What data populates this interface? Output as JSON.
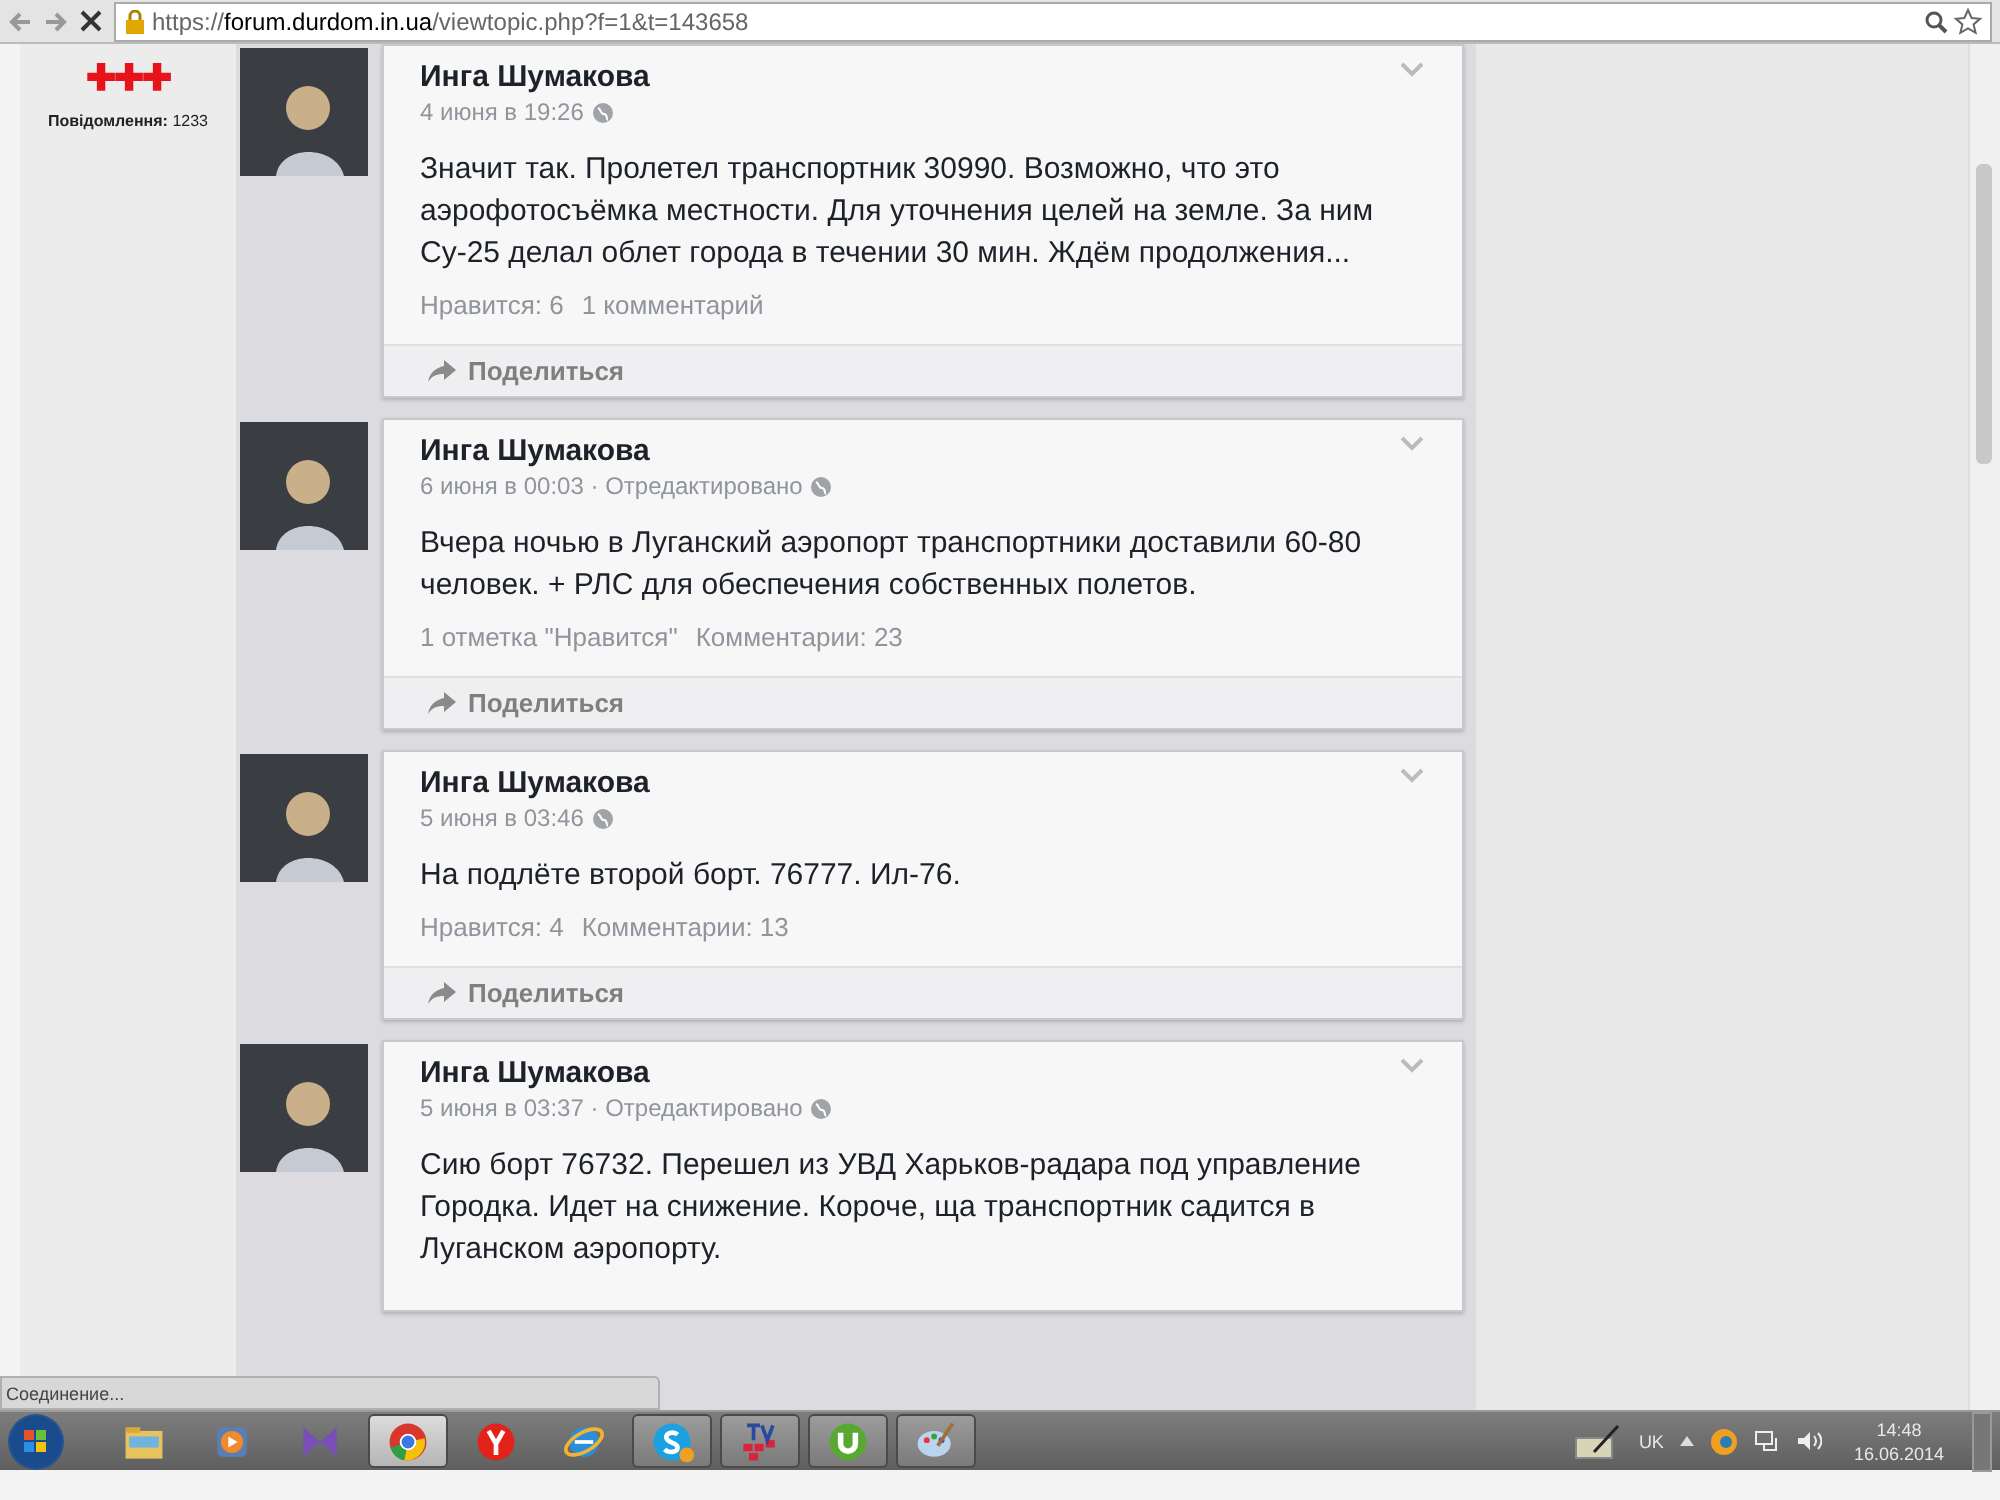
{
  "browser": {
    "url_scheme": "https://",
    "url_host": "forum.durdom.in.ua",
    "url_path": "/viewtopic.php?f=1&t=143658"
  },
  "user_panel": {
    "rank_icons": "✚✚✚",
    "posts_label": "Повідомлення:",
    "posts_count": "1233"
  },
  "posts": [
    {
      "author": "Инга Шумакова",
      "time": "4 июня в 19:26",
      "text": "Значит так. Пролетел транспортник 30990. Возможно, что это аэрофотосъёмка местности. Для уточнения целей на земле. За ним Су-25 делал облет города в течении 30 мин. Ждём продолжения...",
      "likes": "Нравится: 6",
      "comments": "1 комментарий",
      "share": "Поделиться"
    },
    {
      "author": "Инга Шумакова",
      "time": "6 июня в 00:03 · Отредактировано",
      "text": "Вчера ночью в Луганский аэропорт транспортники доставили 60-80 человек. + РЛС для обеспечения собственных полетов.",
      "likes": "1 отметка \"Нравится\"",
      "comments": "Комментарии: 23",
      "share": "Поделиться"
    },
    {
      "author": "Инга Шумакова",
      "time": "5 июня в 03:46",
      "text": "На подлёте второй борт. 76777. Ил-76.",
      "likes": "Нравится: 4",
      "comments": "Комментарии: 13",
      "share": "Поделиться"
    },
    {
      "author": "Инга Шумакова",
      "time": "5 июня в 03:37 · Отредактировано",
      "text": "Сию борт 76732. Перешел из УВД Харьков-радара под управление Городка. Идет на снижение.  Короче, ща транспортник садится в Луганском аэропорту."
    }
  ],
  "status_text": "Соединение...",
  "taskbar": {
    "items": [
      {
        "kind": "folder",
        "running": false,
        "selected": false
      },
      {
        "kind": "media",
        "running": false,
        "selected": false
      },
      {
        "kind": "bowtie",
        "running": false,
        "selected": false
      },
      {
        "kind": "chrome",
        "running": true,
        "selected": true
      },
      {
        "kind": "yandex",
        "running": false,
        "selected": false
      },
      {
        "kind": "ie",
        "running": false,
        "selected": false
      },
      {
        "kind": "skype",
        "running": true,
        "selected": false
      },
      {
        "kind": "tv",
        "running": true,
        "selected": false
      },
      {
        "kind": "torrent",
        "running": true,
        "selected": false
      },
      {
        "kind": "paint",
        "running": true,
        "selected": false
      }
    ],
    "language": "UK",
    "time": "14:48",
    "date": "16.06.2014"
  }
}
